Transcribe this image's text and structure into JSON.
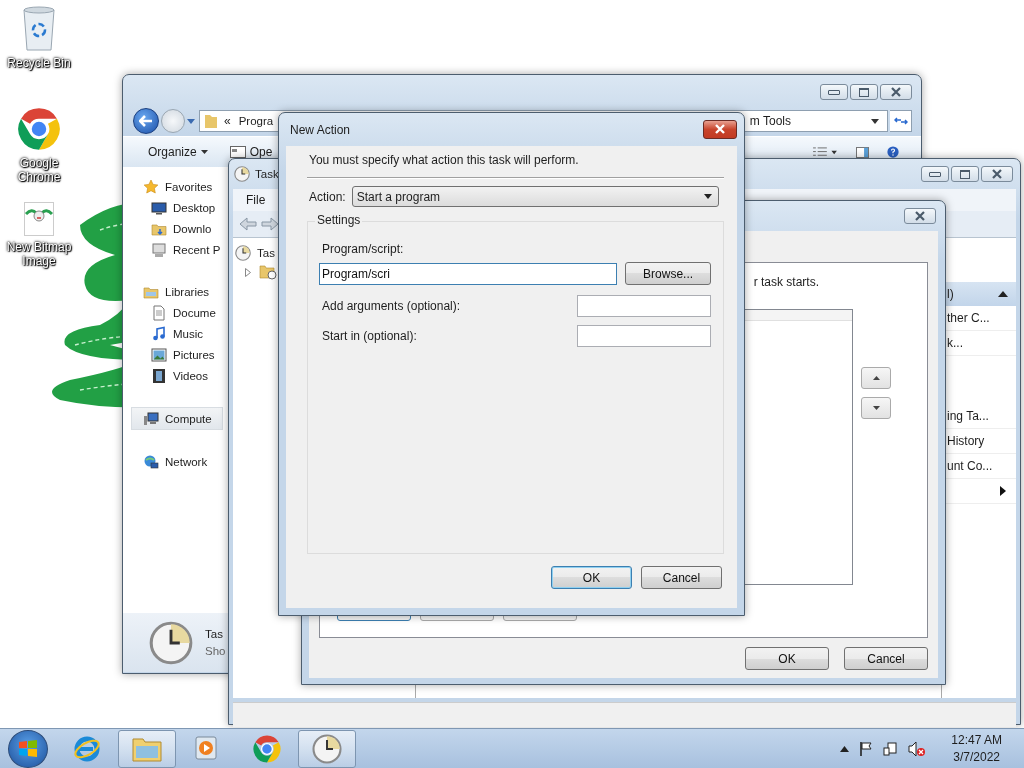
{
  "desktop_icons": [
    {
      "kind": "recycle",
      "label": "Recycle Bin"
    },
    {
      "kind": "chrome",
      "label": "Google Chrome"
    },
    {
      "kind": "bitmap",
      "label": "New Bitmap Image"
    }
  ],
  "explorer": {
    "address_prefix": "«",
    "address_text": "Progra",
    "address_tail": "m Tools",
    "toolbar": [
      "Organize",
      "Ope"
    ],
    "nav": [
      {
        "kind": "group",
        "label": "Favorites",
        "selected": false
      },
      {
        "kind": "item",
        "label": "Desktop",
        "selected": false
      },
      {
        "kind": "item",
        "label": "Downlo",
        "selected": false
      },
      {
        "kind": "item",
        "label": "Recent P",
        "selected": false
      },
      {
        "kind": "group",
        "label": "Libraries",
        "selected": false
      },
      {
        "kind": "item",
        "label": "Docume",
        "selected": false
      },
      {
        "kind": "item",
        "label": "Music",
        "selected": false
      },
      {
        "kind": "item",
        "label": "Pictures",
        "selected": false
      },
      {
        "kind": "item",
        "label": "Videos",
        "selected": false
      },
      {
        "kind": "group",
        "label": "Compute",
        "selected": true
      },
      {
        "kind": "group",
        "label": "Network",
        "selected": false
      }
    ],
    "details": {
      "title": "Tas",
      "subtitle": "Sho"
    }
  },
  "task_scheduler": {
    "title": "Task",
    "menu": [
      "File"
    ],
    "tree": [
      "Tas"
    ],
    "actions_header": "l)",
    "actions": [
      {
        "kind": "text",
        "label": "ther C..."
      },
      {
        "kind": "text",
        "label": "k..."
      },
      {
        "kind": "gap"
      },
      {
        "kind": "gap"
      },
      {
        "kind": "text",
        "label": "ing Ta..."
      },
      {
        "kind": "text",
        "label": "History"
      },
      {
        "kind": "text",
        "label": "unt Co..."
      },
      {
        "kind": "submenu"
      }
    ]
  },
  "create_task": {
    "hint": "r task starts.",
    "buttons": [
      "OK",
      "Cancel"
    ]
  },
  "new_action": {
    "title": "New Action",
    "instruction": "You must specify what action this task will perform.",
    "action_label": "Action:",
    "action_value": "Start a program",
    "group_label": "Settings",
    "fields": [
      {
        "kind": "stacked",
        "label": "Program/script:",
        "value": "Program/scri",
        "focused": true
      },
      {
        "kind": "inline",
        "label": "Add arguments (optional):",
        "focused": false
      },
      {
        "kind": "inline",
        "label": "Start in (optional):",
        "focused": false
      }
    ],
    "browse": "Browse...",
    "buttons": [
      {
        "label": "OK",
        "default": true
      },
      {
        "label": "Cancel",
        "default": false
      }
    ]
  },
  "taskbar": {
    "apps": [
      {
        "kind": "ie",
        "active": false
      },
      {
        "kind": "explorer",
        "active": true
      },
      {
        "kind": "media",
        "active": false
      },
      {
        "kind": "chrome",
        "active": false
      },
      {
        "kind": "scheduler",
        "active": true
      }
    ],
    "time": "12:47 AM",
    "date": "3/7/2022"
  }
}
